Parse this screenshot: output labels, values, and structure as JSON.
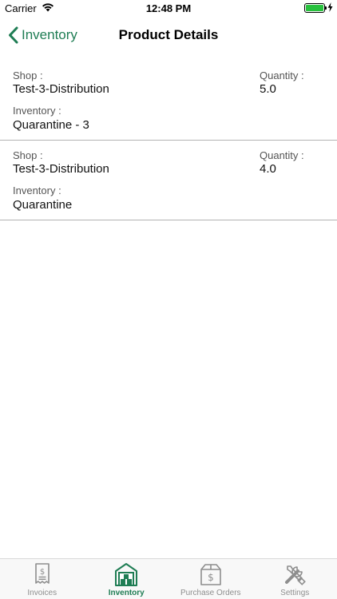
{
  "status_bar": {
    "carrier": "Carrier",
    "time": "12:48 PM",
    "battery_level": 1.0,
    "battery_color": "#27c13d"
  },
  "nav": {
    "back_label": "Inventory",
    "title": "Product Details",
    "accent_color": "#1f7d54"
  },
  "rows": [
    {
      "shop_label": "Shop :",
      "shop_value": "Test-3-Distribution",
      "quantity_label": "Quantity :",
      "quantity_value": "5.0",
      "inventory_label": "Inventory :",
      "inventory_value": "Quarantine - 3"
    },
    {
      "shop_label": "Shop :",
      "shop_value": "Test-3-Distribution",
      "quantity_label": "Quantity :",
      "quantity_value": "4.0",
      "inventory_label": "Inventory :",
      "inventory_value": "Quarantine"
    }
  ],
  "tab_bar": {
    "tabs": [
      {
        "label": "Invoices",
        "icon": "invoice-icon",
        "active": false
      },
      {
        "label": "Inventory",
        "icon": "warehouse-icon",
        "active": true
      },
      {
        "label": "Purchase Orders",
        "icon": "dollar-box-icon",
        "active": false
      },
      {
        "label": "Settings",
        "icon": "tools-icon",
        "active": false
      }
    ]
  }
}
